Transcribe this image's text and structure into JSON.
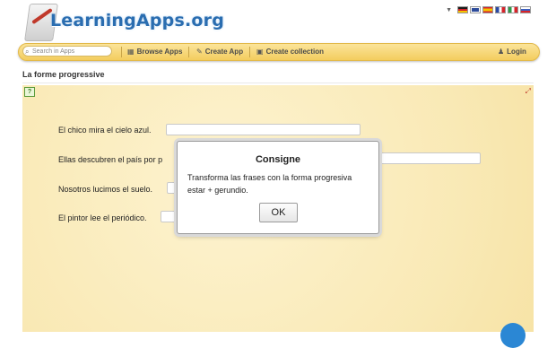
{
  "header": {
    "logo_text": "LearningApps.org",
    "flags": [
      {
        "name": "flag-de",
        "color": "#1b1b1b"
      },
      {
        "name": "flag-uk",
        "color": "#2d4b9a"
      },
      {
        "name": "flag-es",
        "color": "#d8232a"
      },
      {
        "name": "flag-fr",
        "color": "#2b49a4"
      },
      {
        "name": "flag-it",
        "color": "#2f9a47"
      },
      {
        "name": "flag-ru",
        "color": "#3d5fbf"
      }
    ]
  },
  "toolbar": {
    "search_placeholder": "Search in Apps",
    "browse_label": "Browse Apps",
    "create_app_label": "Create App",
    "create_collection_label": "Create collection",
    "login_label": "Login"
  },
  "page": {
    "title": "La forme progressive"
  },
  "exercise": {
    "rows": [
      {
        "text": "El chico mira el cielo azul.",
        "value": ""
      },
      {
        "text": "Ellas descubren el país por p",
        "value": ""
      },
      {
        "text": "Nosotros lucimos el suelo.",
        "value": ""
      },
      {
        "text": "El pintor lee el periódico.",
        "value": ""
      }
    ]
  },
  "dialog": {
    "title": "Consigne",
    "message": "Transforma las frases con la forma progresiva estar + gerundio.",
    "ok_label": "OK"
  },
  "colors": {
    "toolbar": "#f3cd5e",
    "app_background": "#fcefc0",
    "logo_text": "#2a6db0"
  }
}
